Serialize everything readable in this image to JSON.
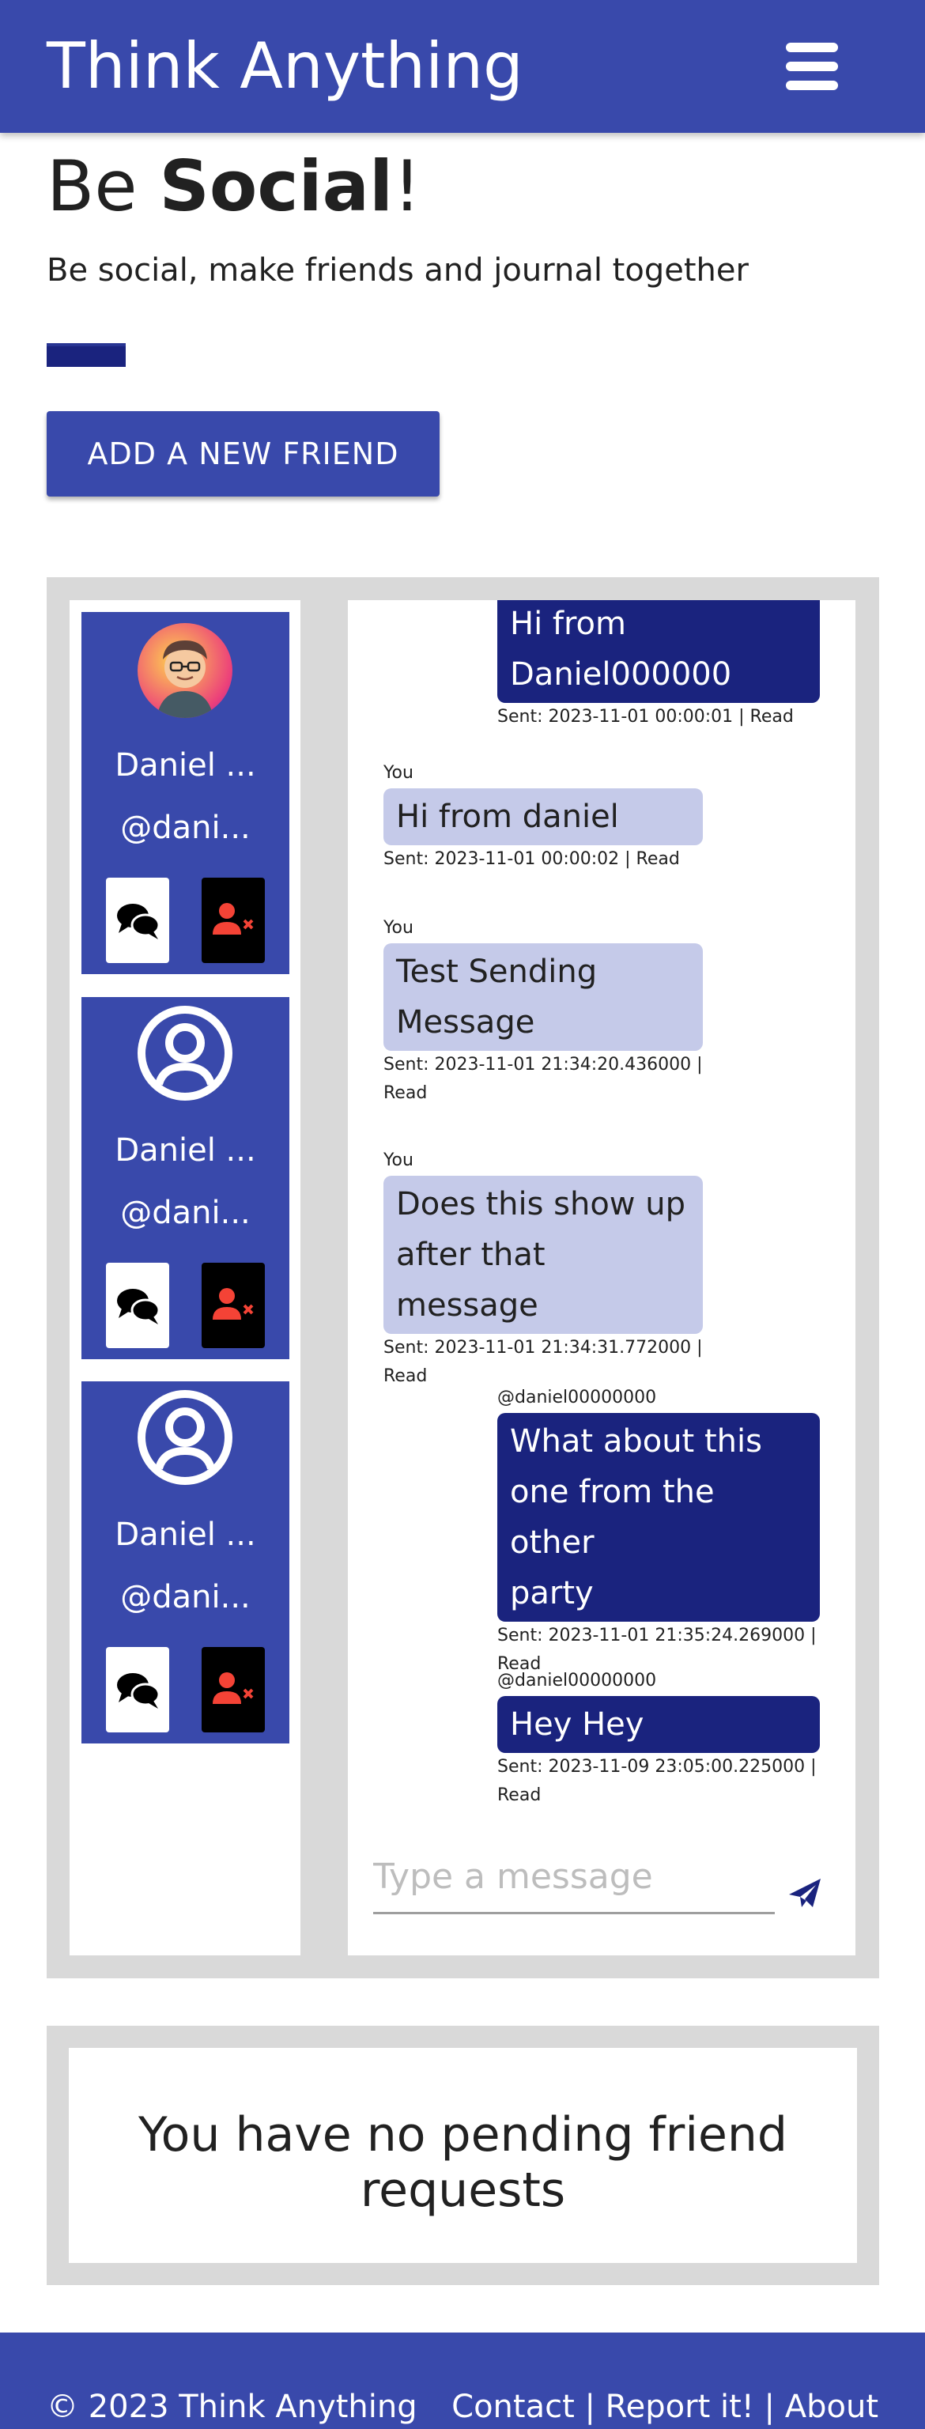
{
  "header": {
    "brand": "Think Anything",
    "menu_icon": "hamburger-menu-icon"
  },
  "hero": {
    "title_prefix": "Be ",
    "title_bold": "Social",
    "title_suffix": "!",
    "subtitle": "Be social, make friends and journal together",
    "add_friend_label": "ADD A NEW FRIEND"
  },
  "friends": [
    {
      "name": "Daniel ...",
      "handle": "@dani...",
      "avatar": "photo-avatar"
    },
    {
      "name": "Daniel ...",
      "handle": "@dani...",
      "avatar": "user-circle-icon"
    },
    {
      "name": "Daniel ...",
      "handle": "@dani...",
      "avatar": "user-circle-icon"
    }
  ],
  "messages": [
    {
      "sender": "",
      "text_lines": [
        "Hi from",
        "Daniel000000"
      ],
      "meta_lines": [
        "Sent: 2023-11-01 00:00:01 | Read"
      ],
      "mine": false
    },
    {
      "sender": "You",
      "text_lines": [
        "Hi from daniel"
      ],
      "meta_lines": [
        "Sent: 2023-11-01 00:00:02 | Read"
      ],
      "mine": true
    },
    {
      "sender": "You",
      "text_lines": [
        "Test Sending",
        "Message"
      ],
      "meta_lines": [
        "Sent: 2023-11-01 21:34:20.436000 |",
        "Read"
      ],
      "mine": true
    },
    {
      "sender": "You",
      "text_lines": [
        "Does this show up",
        "after that message"
      ],
      "meta_lines": [
        "Sent: 2023-11-01 21:34:31.772000 |",
        "Read"
      ],
      "mine": true
    },
    {
      "sender": "@daniel00000000",
      "text_lines": [
        "What about this",
        "one from the other",
        "party"
      ],
      "meta_lines": [
        "Sent: 2023-11-01 21:35:24.269000 |",
        "Read"
      ],
      "mine": false
    },
    {
      "sender": "@daniel00000000",
      "text_lines": [
        "Hey Hey"
      ],
      "meta_lines": [
        "Sent: 2023-11-09 23:05:00.225000 |",
        "Read"
      ],
      "mine": false
    }
  ],
  "composer": {
    "placeholder": "Type a message",
    "send_icon": "send-icon"
  },
  "pending": {
    "empty_text": "You have no pending friend requests"
  },
  "footer": {
    "copyright": "© 2023 Think Anything",
    "contact": "Contact",
    "report": "Report it!",
    "about": "About",
    "separator": " | "
  },
  "colors": {
    "primary": "#3949ab",
    "dark": "#1a237e",
    "light_bubble": "#c5cae9",
    "panel": "#d9d9d9",
    "remove": "#f44336"
  }
}
